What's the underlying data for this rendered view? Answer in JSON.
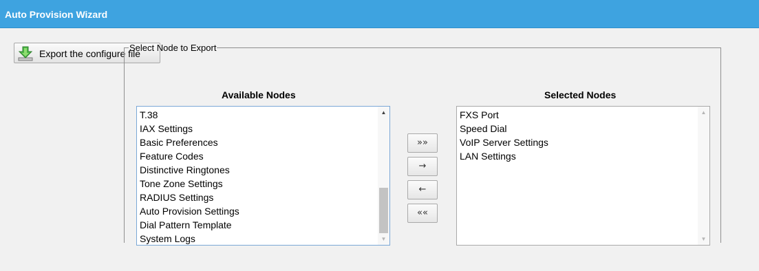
{
  "window": {
    "title": "Auto Provision Wizard"
  },
  "toolbar": {
    "export_label": "Export the configure file",
    "export_icon": "download-arrow-icon"
  },
  "fieldset": {
    "legend": "Select Node to Export"
  },
  "available": {
    "header": "Available Nodes",
    "items": [
      "T.38",
      "IAX Settings",
      "Basic Preferences",
      "Feature Codes",
      "Distinctive Ringtones",
      "Tone Zone Settings",
      "RADIUS Settings",
      "Auto Provision Settings",
      "Dial Pattern Template",
      "System Logs"
    ],
    "scroll_position": 1.0
  },
  "selected": {
    "header": "Selected Nodes",
    "items": [
      "FXS Port",
      "Speed Dial",
      "VoIP Server Settings",
      "LAN Settings"
    ]
  },
  "move_buttons": {
    "add_all": "»»",
    "add_one": "→",
    "remove_one": "←",
    "remove_all": "««"
  },
  "colors": {
    "title_bar": "#3ea3e0",
    "background": "#f1f1f1",
    "focus_border": "#7aa7d6"
  }
}
